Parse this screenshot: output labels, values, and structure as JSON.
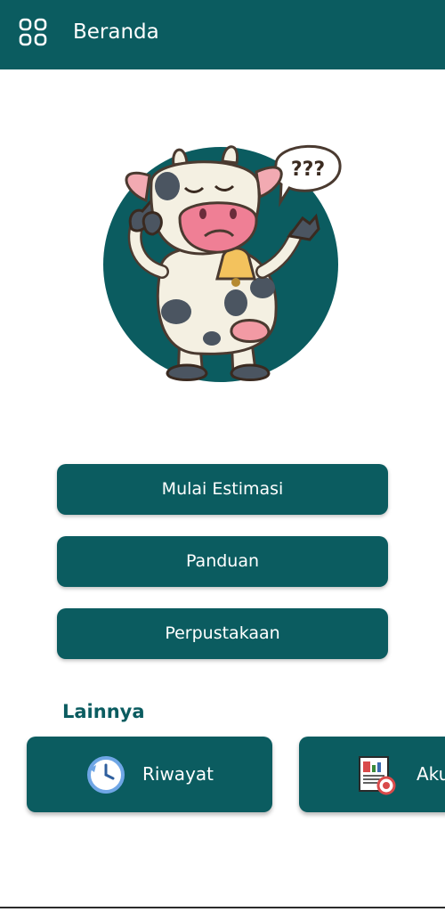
{
  "app_bar": {
    "title": "Beranda",
    "icon": "grid-menu-icon",
    "color": "#0b5c60"
  },
  "hero": {
    "illustration": "confused-cow-illustration",
    "speech_bubble_text": "???"
  },
  "main_actions": [
    {
      "label": "Mulai Estimasi"
    },
    {
      "label": "Panduan"
    },
    {
      "label": "Perpustakaan"
    }
  ],
  "others": {
    "title": "Lainnya",
    "cards": [
      {
        "label": "Riwayat",
        "icon": "history-clock-icon"
      },
      {
        "label": "Aku",
        "icon": "report-document-icon"
      }
    ]
  }
}
